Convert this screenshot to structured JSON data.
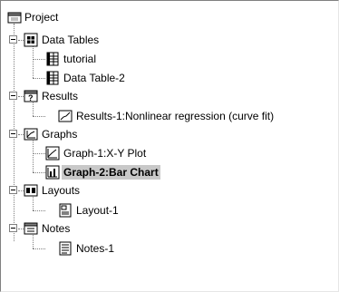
{
  "tree": {
    "root": {
      "label": "Project",
      "icon": "project-icon"
    },
    "groups": [
      {
        "label": "Data Tables",
        "icon": "data-tables-folder-icon",
        "children": [
          {
            "label": "tutorial",
            "icon": "data-table-icon"
          },
          {
            "label": "Data Table-2",
            "icon": "data-table-icon"
          }
        ]
      },
      {
        "label": "Results",
        "icon": "results-folder-icon",
        "children": [
          {
            "label": "Results-1:Nonlinear regression (curve fit)",
            "icon": "results-icon"
          }
        ]
      },
      {
        "label": "Graphs",
        "icon": "graphs-folder-icon",
        "children": [
          {
            "label": "Graph-1:X-Y Plot",
            "icon": "xy-graph-icon"
          },
          {
            "label": "Graph-2:Bar Chart",
            "icon": "bar-chart-icon",
            "selected": true
          }
        ]
      },
      {
        "label": "Layouts",
        "icon": "layouts-folder-icon",
        "children": [
          {
            "label": "Layout-1",
            "icon": "layout-icon"
          }
        ]
      },
      {
        "label": "Notes",
        "icon": "notes-folder-icon",
        "children": [
          {
            "label": "Notes-1",
            "icon": "notes-icon"
          }
        ]
      }
    ]
  },
  "colors": {
    "selection": "#c8c8c8",
    "tree_lines": "#808080"
  }
}
